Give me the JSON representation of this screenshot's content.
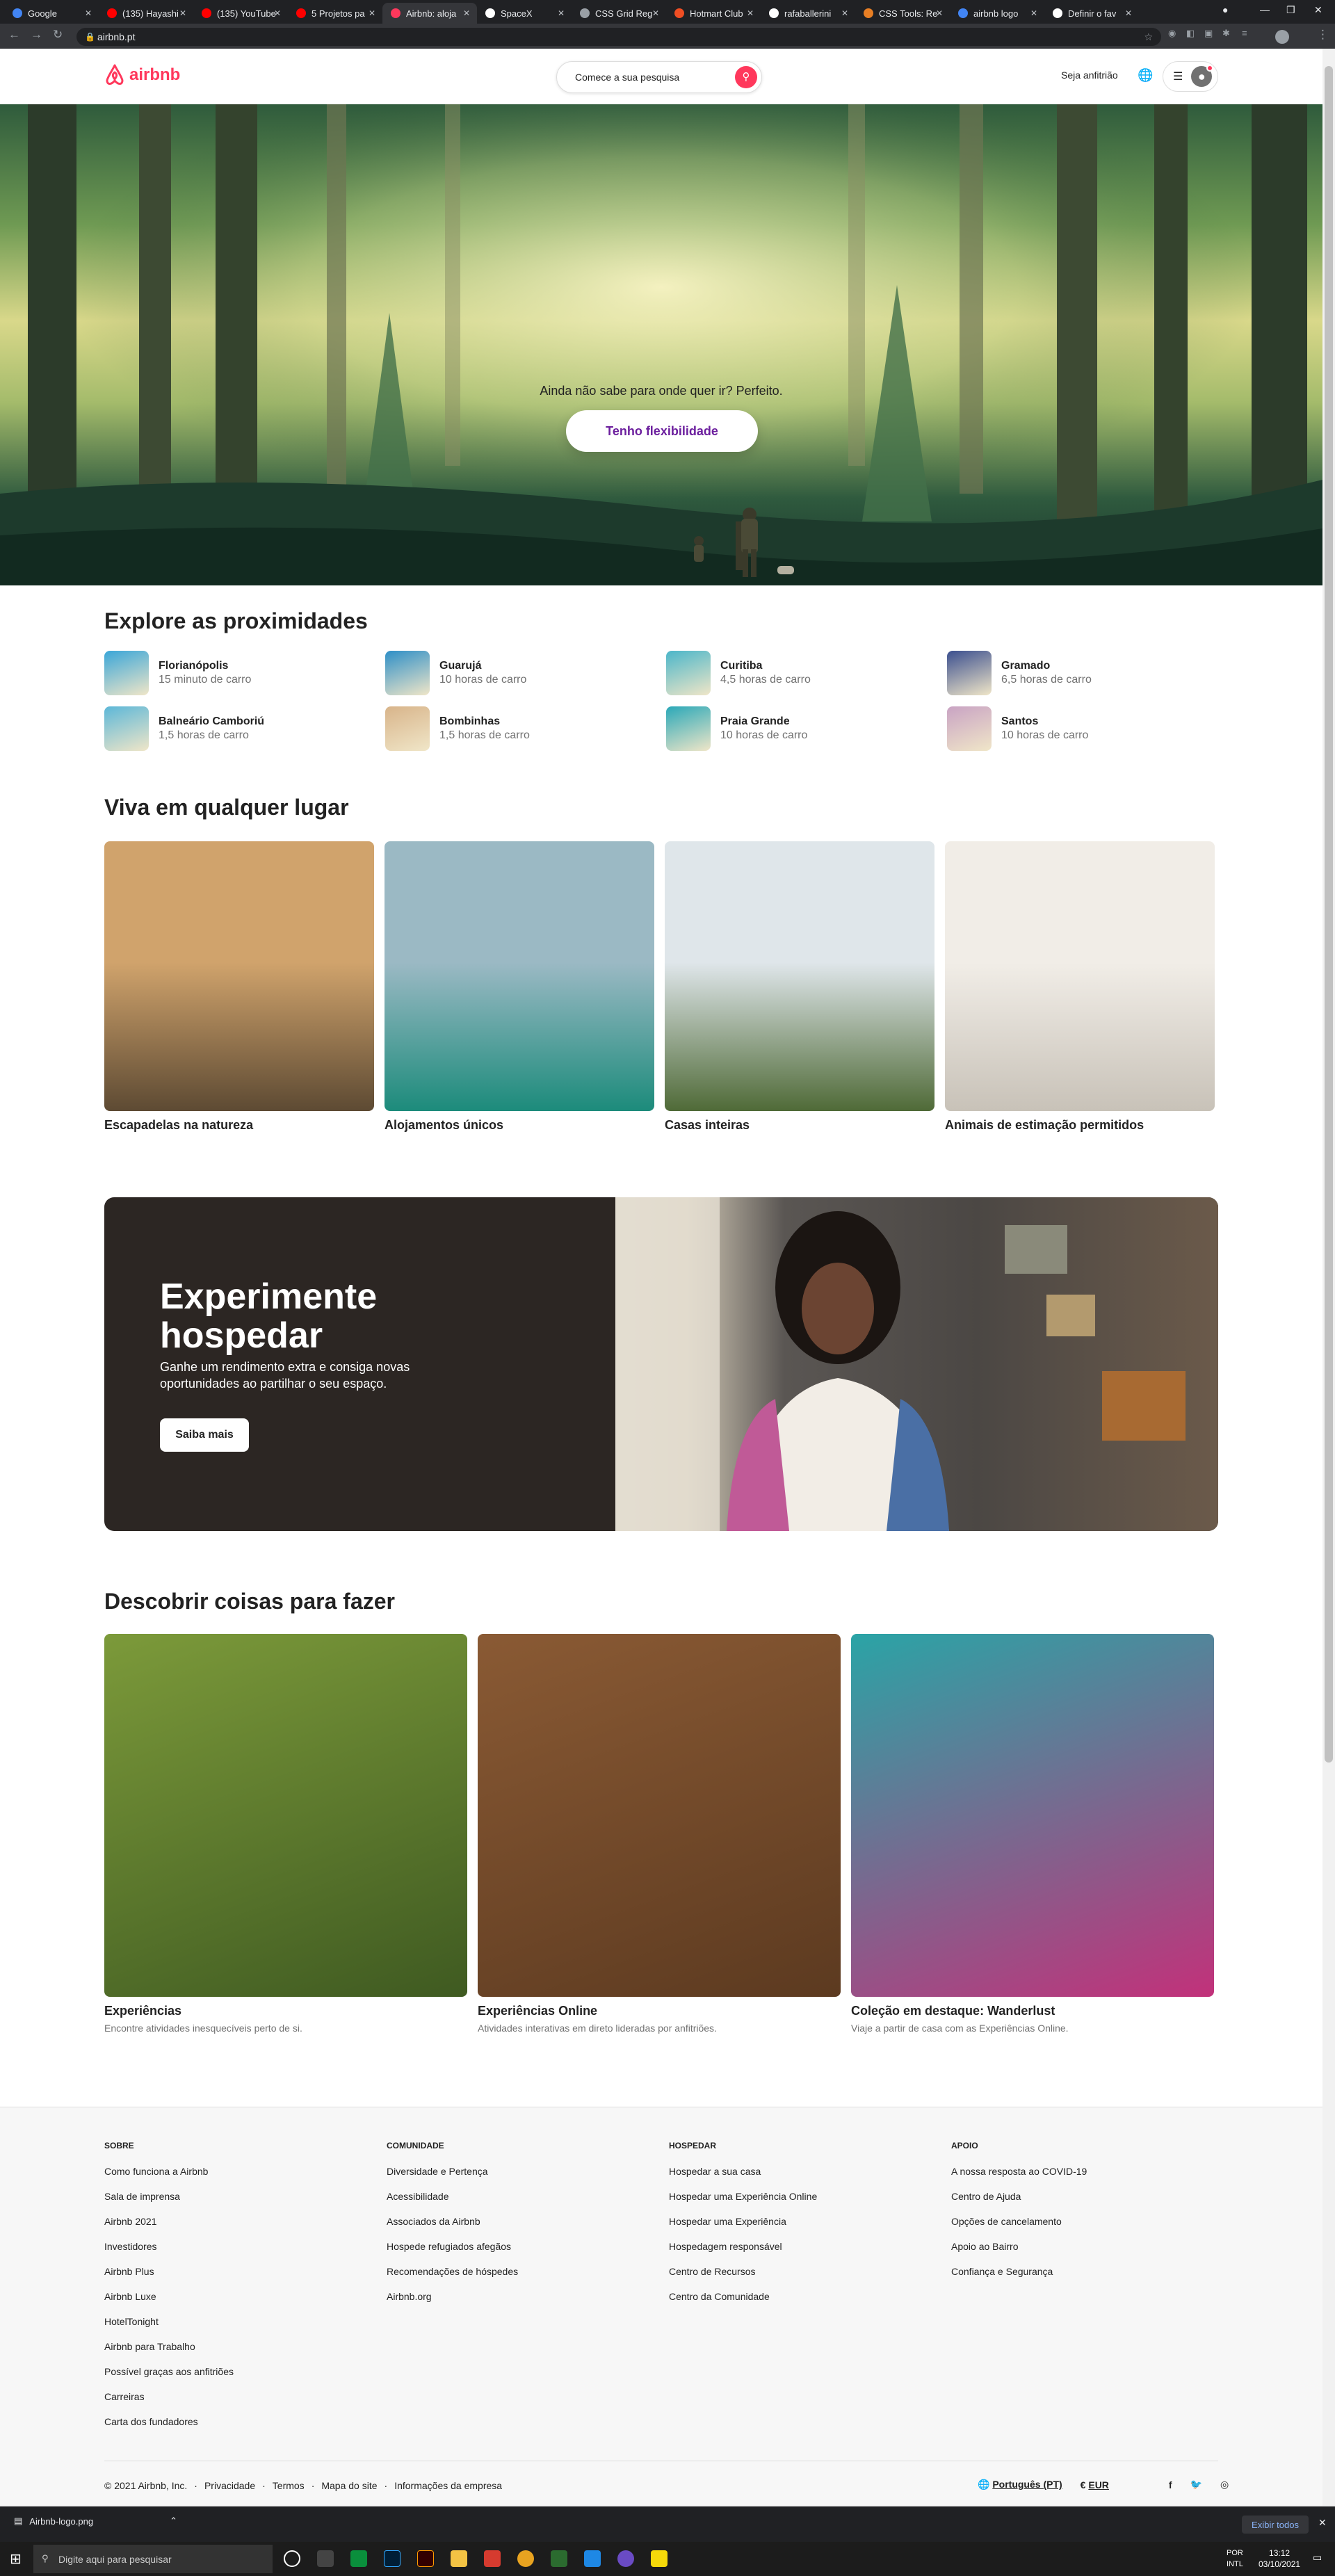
{
  "browser": {
    "tabs": [
      {
        "title": "Google",
        "color": "#4285f4"
      },
      {
        "title": "(135) Hayashi",
        "color": "#ff0000"
      },
      {
        "title": "(135) YouTube",
        "color": "#ff0000"
      },
      {
        "title": "5 Projetos pa",
        "color": "#ff0000"
      },
      {
        "title": "Airbnb: aloja",
        "color": "#ff385c"
      },
      {
        "title": "SpaceX",
        "color": "#ffffff"
      },
      {
        "title": "CSS Grid Reg",
        "color": "#9aa0a6"
      },
      {
        "title": "Hotmart Club",
        "color": "#f04e23"
      },
      {
        "title": "rafaballerini",
        "color": "#ffffff"
      },
      {
        "title": "CSS Tools: Re",
        "color": "#e87f24"
      },
      {
        "title": "airbnb logo",
        "color": "#4285f4"
      },
      {
        "title": "Definir o fav",
        "color": "#ffffff"
      }
    ],
    "url": "airbnb.pt",
    "download_file": "Airbnb-logo.png",
    "download_show_all": "Exibir todos"
  },
  "header": {
    "logo_text": "airbnb",
    "search_placeholder": "Comece a sua pesquisa",
    "host_link": "Seja anfitrião"
  },
  "hero": {
    "question": "Ainda não sabe para onde quer ir? Perfeito.",
    "button": "Tenho flexibilidade"
  },
  "nearby": {
    "title": "Explore as proximidades",
    "items": [
      {
        "name": "Florianópolis",
        "dist": "15 minuto de carro",
        "color": "#3aa6d8"
      },
      {
        "name": "Guarujá",
        "dist": "10 horas de carro",
        "color": "#2e8fc7"
      },
      {
        "name": "Curitiba",
        "dist": "4,5 horas de carro",
        "color": "#4bb6c9"
      },
      {
        "name": "Gramado",
        "dist": "6,5 horas de carro",
        "color": "#3b4f8f"
      },
      {
        "name": "Balneário Camboriú",
        "dist": "1,5 horas de carro",
        "color": "#5cb7d8"
      },
      {
        "name": "Bombinhas",
        "dist": "1,5 horas de carro",
        "color": "#d8b48a"
      },
      {
        "name": "Praia Grande",
        "dist": "10 horas de carro",
        "color": "#2aa8b8"
      },
      {
        "name": "Santos",
        "dist": "10 horas de carro",
        "color": "#c9a3c4"
      }
    ]
  },
  "anywhere": {
    "title": "Viva em qualquer lugar",
    "cards": [
      {
        "label": "Escapadelas na natureza",
        "c1": "#d0a36c",
        "c2": "#5d4a33"
      },
      {
        "label": "Alojamentos únicos",
        "c1": "#9bb9c4",
        "c2": "#1c8b7b"
      },
      {
        "label": "Casas inteiras",
        "c1": "#dfe6ea",
        "c2": "#4f6a37"
      },
      {
        "label": "Animais de estimação permitidos",
        "c1": "#f1ede7",
        "c2": "#c8c2b8"
      }
    ]
  },
  "hosting": {
    "title": "Experimente hospedar",
    "subtitle": "Ganhe um rendimento extra e consiga novas oportunidades ao partilhar o seu espaço.",
    "button": "Saiba mais"
  },
  "experiences": {
    "title": "Descobrir coisas para fazer",
    "cards": [
      {
        "title": "Experiências",
        "sub": "Encontre atividades inesquecíveis perto de si.",
        "c1": "#7c9a3a",
        "c2": "#3f5a21"
      },
      {
        "title": "Experiências Online",
        "sub": "Atividades interativas em direto lideradas por anfitriões.",
        "c1": "#8a5a34",
        "c2": "#5c3a20"
      },
      {
        "title": "Coleção em destaque: Wanderlust",
        "sub": "Viaje a partir de casa com as Experiências Online.",
        "c1": "#2aa4a6",
        "c2": "#c2317a"
      }
    ]
  },
  "footer": {
    "columns": [
      {
        "heading": "SOBRE",
        "links": [
          "Como funciona a Airbnb",
          "Sala de imprensa",
          "Airbnb 2021",
          "Investidores",
          "Airbnb Plus",
          "Airbnb Luxe",
          "HotelTonight",
          "Airbnb para Trabalho",
          "Possível graças aos anfitriões",
          "Carreiras",
          "Carta dos fundadores"
        ]
      },
      {
        "heading": "COMUNIDADE",
        "links": [
          "Diversidade e Pertença",
          "Acessibilidade",
          "Associados da Airbnb",
          "Hospede refugiados afegãos",
          "Recomendações de hóspedes",
          "Airbnb.org"
        ]
      },
      {
        "heading": "HOSPEDAR",
        "links": [
          "Hospedar a sua casa",
          "Hospedar uma Experiência Online",
          "Hospedar uma Experiência",
          "Hospedagem responsável",
          "Centro de Recursos",
          "Centro da Comunidade"
        ]
      },
      {
        "heading": "APOIO",
        "links": [
          "A nossa resposta ao COVID-19",
          "Centro de Ajuda",
          "Opções de cancelamento",
          "Apoio ao Bairro",
          "Confiança e Segurança"
        ]
      }
    ],
    "copyright": "© 2021 Airbnb, Inc.",
    "legal": [
      "Privacidade",
      "Termos",
      "Mapa do site",
      "Informações da empresa"
    ],
    "language": "Português (PT)",
    "currency_symbol": "€",
    "currency": "EUR"
  },
  "taskbar": {
    "search": "Digite aqui para pesquisar",
    "lang1": "POR",
    "lang2": "INTL",
    "time": "13:12",
    "date": "03/10/2021"
  }
}
